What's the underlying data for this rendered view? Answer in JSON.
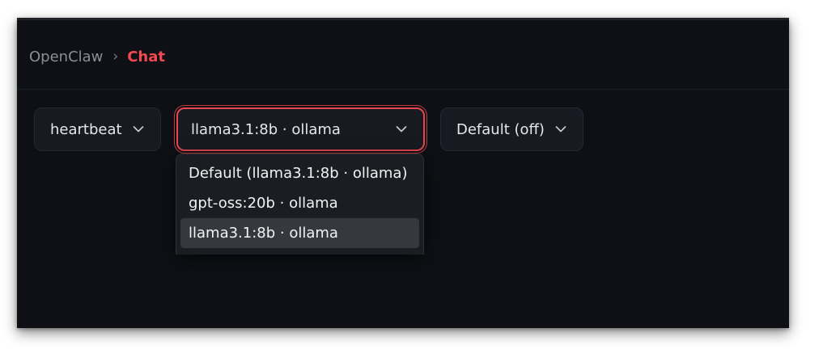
{
  "breadcrumb": {
    "app": "OpenClaw",
    "separator": "›",
    "current": "Chat"
  },
  "controls": {
    "agent": {
      "value": "heartbeat"
    },
    "model": {
      "value": "llama3.1:8b · ollama",
      "options": [
        {
          "label": "Default (llama3.1:8b · ollama)"
        },
        {
          "label": "gpt-oss:20b · ollama"
        },
        {
          "label": "llama3.1:8b · ollama",
          "selected": true
        }
      ]
    },
    "thinking": {
      "value": "Default (off)"
    }
  },
  "colors": {
    "background": "#0e1015",
    "accent": "#f0494f",
    "select_bg": "#171a21",
    "dropdown_bg": "#1c1d22",
    "option_selected_bg": "#36383e"
  },
  "icons": [
    "chevron-down-icon"
  ]
}
